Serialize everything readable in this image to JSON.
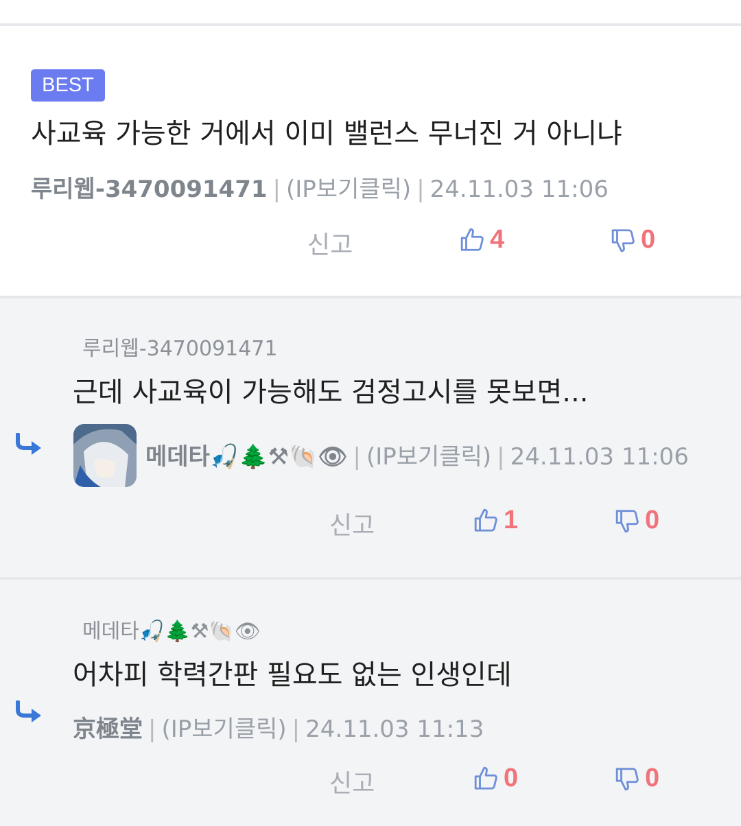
{
  "best": {
    "badge": "BEST",
    "text": "사교육 가능한 거에서 이미 밸런스 무너진 거 아니냐",
    "author": "루리웹-3470091471",
    "ip": "(IP보기클릭)",
    "time": "24.11.03 11:06",
    "report": "신고",
    "likes": "4",
    "dislikes": "0"
  },
  "reply1": {
    "quote": "루리웹-3470091471",
    "text": "근데 사교육이 가능해도 검정고시를 못보면...",
    "author": "메데타🎣🌲⚒🐚👁",
    "ip": "(IP보기클릭)",
    "time": "24.11.03 11:06",
    "report": "신고",
    "likes": "1",
    "dislikes": "0"
  },
  "reply2": {
    "quote": "메데타🎣🌲⚒🐚👁",
    "text": "어차피 학력간판 필요도 없는 인생인데",
    "author": "京極堂",
    "ip": "(IP보기클릭)",
    "time": "24.11.03 11:13",
    "report": "신고",
    "likes": "0",
    "dislikes": "0"
  },
  "colors": {
    "badge": "#6a7cf0",
    "count": "#f0737b",
    "thumb": "#6f8fd8",
    "reply_arrow": "#3a78d8"
  },
  "icons": [
    "thumbs-up-icon",
    "thumbs-down-icon",
    "reply-arrow-icon",
    "avatar"
  ]
}
